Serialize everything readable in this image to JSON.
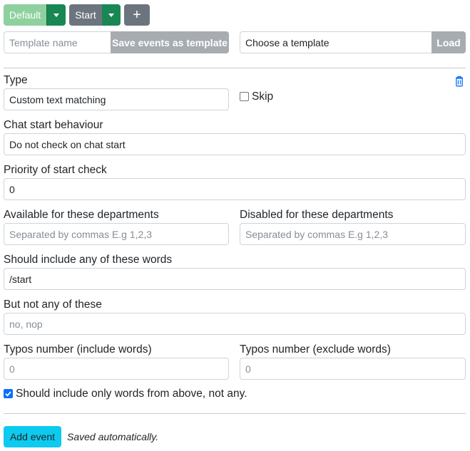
{
  "toolbar": {
    "default_label": "Default",
    "start_label": "Start",
    "add_label": "+"
  },
  "template": {
    "name_placeholder": "Template name",
    "save_label": "Save events as template",
    "choose_value": "Choose a template",
    "load_label": "Load"
  },
  "event": {
    "type_label": "Type",
    "type_value": "Custom text matching",
    "skip_label": "Skip",
    "chat_start_label": "Chat start behaviour",
    "chat_start_value": "Do not check on chat start",
    "priority_label": "Priority of start check",
    "priority_value": "0",
    "available_label": "Available for these departments",
    "available_placeholder": "Separated by commas E.g 1,2,3",
    "disabled_label": "Disabled for these departments",
    "disabled_placeholder": "Separated by commas E.g 1,2,3",
    "include_label": "Should include any of these words",
    "include_value": "/start",
    "exclude_label": "But not any of these",
    "exclude_placeholder": "no, nop",
    "typos_include_label": "Typos number (include words)",
    "typos_include_placeholder": "0",
    "typos_exclude_label": "Typos number (exclude words)",
    "typos_exclude_placeholder": "0",
    "only_words_label": "Should include only words from above, not any.",
    "only_words_checked": true,
    "skip_checked": false
  },
  "footer": {
    "add_event_label": "Add event",
    "status_text": "Saved automatically."
  },
  "colors": {
    "success_light": "#8fd19e",
    "success": "#198754",
    "secondary": "#6c757d",
    "secondary_light": "#a7acb1",
    "info": "#0dcaf0",
    "danger_icon": "#0d6efd"
  }
}
